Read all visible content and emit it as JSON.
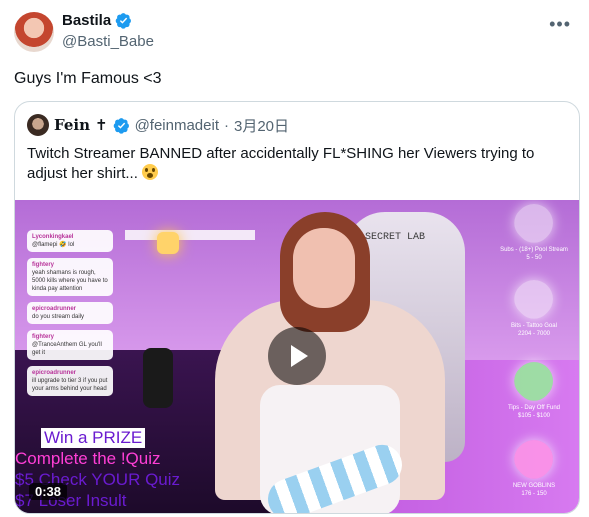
{
  "author": {
    "display_name": "Bastila",
    "handle": "@Basti_Babe",
    "verified": true
  },
  "tweet": {
    "text": "Guys I'm Famous <3"
  },
  "more_icon": "more-horizontal-icon",
  "quoted_tweet": {
    "display_name": "Fein",
    "name_symbol": "✝",
    "handle": "@feinmadeit",
    "separator": "·",
    "date": "3月20日",
    "verified": true,
    "text": "Twitch Streamer BANNED after accidentally FL*SHING her Viewers trying to adjust her shirt...",
    "emoji": "flushed-face-icon",
    "video": {
      "duration": "0:38",
      "chat": [
        {
          "user": "Lyconkingkael",
          "text": "@flamepi 🤣 lol"
        },
        {
          "user": "fightery",
          "text": "yeah shamans is rough, 5000 kills where you have to kinda pay attention"
        },
        {
          "user": "epicroadrunner",
          "text": "do you stream daily"
        },
        {
          "user": "fightery",
          "text": "@TranceAnthem GL you'll get it"
        },
        {
          "user": "epicroadrunner",
          "text": "ill upgrade to tier 3 if you put your arms behind your head"
        }
      ],
      "goals": [
        {
          "label": "Subs - (18+) Pool Stream",
          "value": "5 - 50"
        },
        {
          "label": "Bits - Tattoo Goal",
          "value": "2204 - 7000"
        },
        {
          "label": "Tips - Day Off Fund",
          "value": "$105 - $100"
        },
        {
          "label": "NEW GOBLINS",
          "value": "176 - 150"
        }
      ],
      "promo": {
        "title": "Win a PRIZE",
        "line1": "Complete the !Quiz",
        "line2": "$5 Check YOUR Quiz",
        "line3": "$7 Loser Insult"
      },
      "chair_logo": "SECRET LAB",
      "accent_color": "#c15ce0"
    }
  },
  "colors": {
    "verified": "#1d9bf0",
    "secondary_text": "#536471",
    "border": "#cfd9de"
  }
}
